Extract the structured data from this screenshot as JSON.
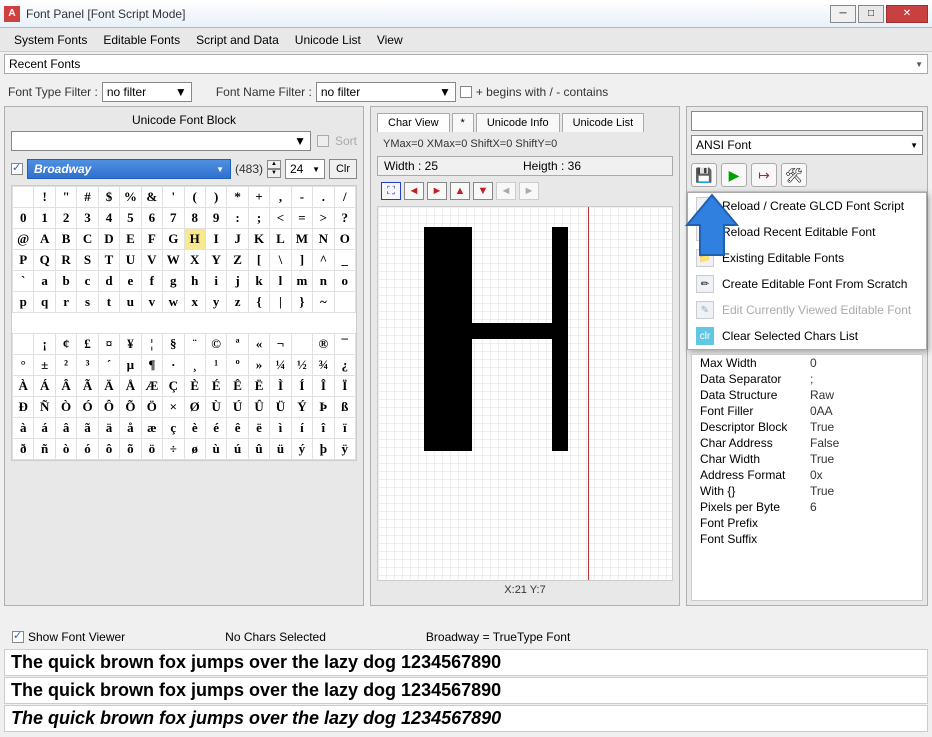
{
  "window": {
    "title": "Font Panel [Font Script Mode]"
  },
  "menubar": {
    "items": [
      "System Fonts",
      "Editable Fonts",
      "Script and Data",
      "Unicode List",
      "View"
    ]
  },
  "recent_combo": {
    "label": "Recent Fonts"
  },
  "filters": {
    "type_label": "Font Type Filter :",
    "type_value": "no filter",
    "name_label": "Font Name Filter :",
    "name_value": "no filter",
    "begins_label": "+ begins with / - contains"
  },
  "left": {
    "block_label": "Unicode Font Block",
    "sort_label": "Sort",
    "font_name": "Broadway",
    "font_count": "(483)",
    "size": "24",
    "clr_label": "Clr",
    "rows": [
      [
        "",
        "!",
        "\"",
        "#",
        "$",
        "%",
        "&",
        "'",
        "(",
        ")",
        "*",
        "+",
        ",",
        "-",
        ".",
        "/"
      ],
      [
        "0",
        "1",
        "2",
        "3",
        "4",
        "5",
        "6",
        "7",
        "8",
        "9",
        ":",
        ";",
        "<",
        "=",
        ">",
        "?"
      ],
      [
        "@",
        "A",
        "B",
        "C",
        "D",
        "E",
        "F",
        "G",
        "H",
        "I",
        "J",
        "K",
        "L",
        "M",
        "N",
        "O"
      ],
      [
        "P",
        "Q",
        "R",
        "S",
        "T",
        "U",
        "V",
        "W",
        "X",
        "Y",
        "Z",
        "[",
        "\\",
        "]",
        "^",
        "_"
      ],
      [
        "`",
        "a",
        "b",
        "c",
        "d",
        "e",
        "f",
        "g",
        "h",
        "i",
        "j",
        "k",
        "l",
        "m",
        "n",
        "o"
      ],
      [
        "p",
        "q",
        "r",
        "s",
        "t",
        "u",
        "v",
        "w",
        "x",
        "y",
        "z",
        "{",
        "|",
        "}",
        "~",
        ""
      ],
      [
        "",
        "",
        "",
        "",
        "",
        "",
        "",
        "",
        "",
        "",
        "",
        "",
        "",
        "",
        "",
        ""
      ],
      [
        "",
        "¡",
        "¢",
        "£",
        "¤",
        "¥",
        "¦",
        "§",
        "¨",
        "©",
        "ª",
        "«",
        "¬",
        "",
        "®",
        "¯"
      ],
      [
        "°",
        "±",
        "²",
        "³",
        "´",
        "µ",
        "¶",
        "·",
        "¸",
        "¹",
        "º",
        "»",
        "¼",
        "½",
        "¾",
        "¿"
      ],
      [
        "À",
        "Á",
        "Â",
        "Ã",
        "Ä",
        "Å",
        "Æ",
        "Ç",
        "È",
        "É",
        "Ê",
        "Ë",
        "Ì",
        "Í",
        "Î",
        "Ï"
      ],
      [
        "Ð",
        "Ñ",
        "Ò",
        "Ó",
        "Ô",
        "Õ",
        "Ö",
        "×",
        "Ø",
        "Ù",
        "Ú",
        "Û",
        "Ü",
        "Ý",
        "Þ",
        "ß"
      ],
      [
        "à",
        "á",
        "â",
        "ã",
        "ä",
        "å",
        "æ",
        "ç",
        "è",
        "é",
        "ê",
        "ë",
        "ì",
        "í",
        "î",
        "ï"
      ],
      [
        "ð",
        "ñ",
        "ò",
        "ó",
        "ô",
        "õ",
        "ö",
        "÷",
        "ø",
        "ù",
        "ú",
        "û",
        "ü",
        "ý",
        "þ",
        "ÿ"
      ]
    ],
    "selected_row": 2,
    "selected_col": 8
  },
  "mid": {
    "tabs": {
      "char_view": "Char View",
      "star": "*",
      "unicode_info": "Unicode Info",
      "unicode_list": "Unicode List"
    },
    "metrics": "YMax=0  XMax=0  ShiftX=0  ShiftY=0",
    "dims": {
      "width_label": "Width : 25",
      "height_label": "Heigth : 36"
    },
    "coord": "X:21 Y:7"
  },
  "right": {
    "font_type": "ANSI Font",
    "menu": [
      {
        "icon": "f",
        "label": "Reload / Create GLCD Font Script",
        "disabled": false
      },
      {
        "icon": "↻",
        "label": "Reload Recent Editable Font",
        "disabled": false
      },
      {
        "icon": "📁",
        "label": "Existing Editable Fonts",
        "disabled": false
      },
      {
        "icon": "✏",
        "label": "Create Editable Font From Scratch",
        "disabled": false
      },
      {
        "icon": "✎",
        "label": "Edit Currently Viewed Editable Font",
        "disabled": true
      },
      {
        "icon": "clr",
        "label": "Clear Selected Chars List",
        "disabled": false,
        "clr": true
      }
    ],
    "props": [
      {
        "label": "Max Width",
        "value": "0"
      },
      {
        "label": "Data Separator",
        "value": ";"
      },
      {
        "label": "Data Structure",
        "value": "Raw"
      },
      {
        "label": "Font Filler",
        "value": "0AA"
      },
      {
        "label": "Descriptor Block",
        "value": "True"
      },
      {
        "label": "Char Address",
        "value": "False"
      },
      {
        "label": "Char Width",
        "value": "True"
      },
      {
        "label": "Address Format",
        "value": "0x"
      },
      {
        "label": "With {}",
        "value": "True"
      },
      {
        "label": "Pixels per Byte",
        "value": "6"
      },
      {
        "label": "Font Prefix",
        "value": ""
      },
      {
        "label": "Font Suffix",
        "value": ""
      }
    ]
  },
  "bottom": {
    "show_viewer": "Show Font Viewer",
    "no_chars": "No Chars Selected",
    "font_type": "Broadway = TrueType Font",
    "sample": "The quick brown fox jumps over the lazy dog 1234567890"
  }
}
